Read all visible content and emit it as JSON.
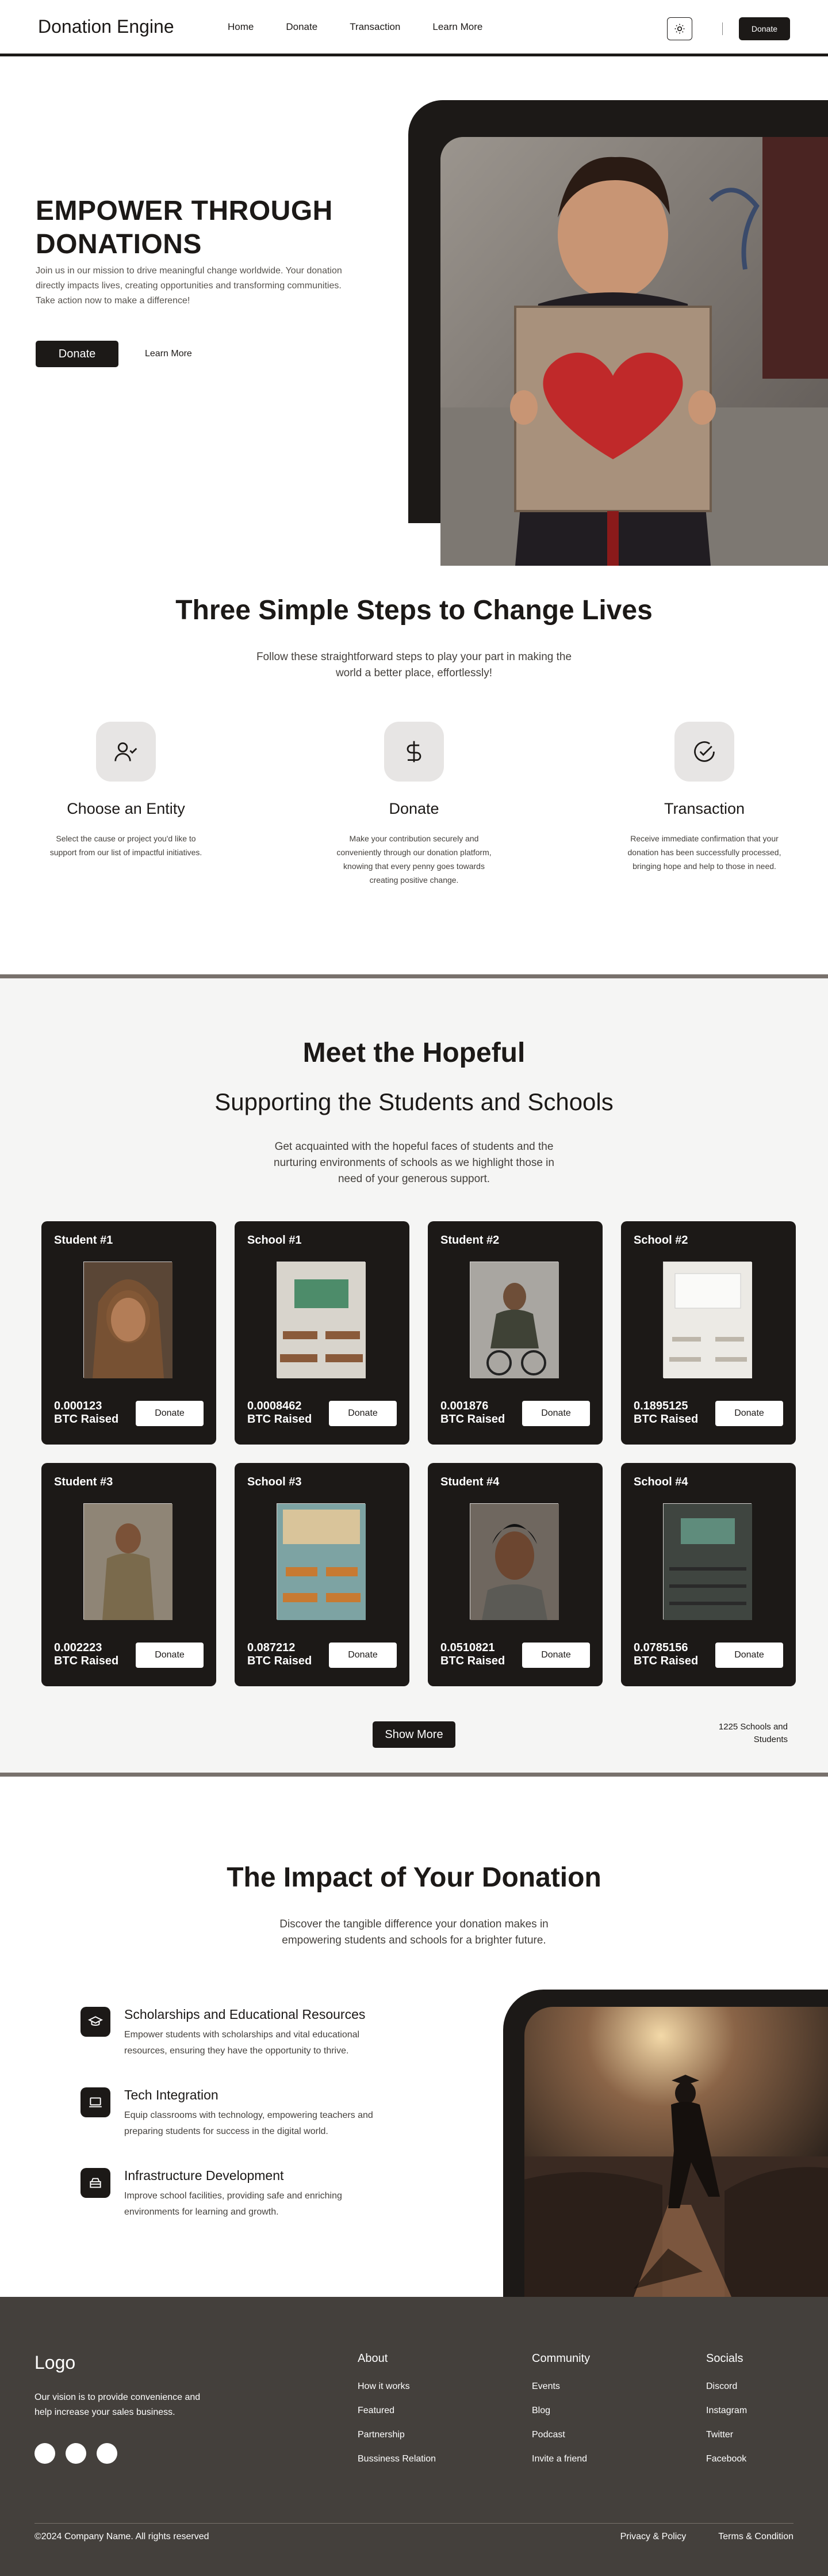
{
  "nav": {
    "brand": "Donation Engine",
    "links": [
      "Home",
      "Donate",
      "Transaction",
      "Learn More"
    ],
    "donate_label": "Donate",
    "theme_icon": "sun-icon"
  },
  "hero": {
    "title": "EMPOWER THROUGH DONATIONS",
    "subtitle": "Join us in our mission to drive meaningful change worldwide. Your donation directly impacts lives, creating opportunities and transforming communities. Take action now to make a difference!",
    "primary_label": "Donate",
    "secondary_label": "Learn More"
  },
  "steps": {
    "title": "Three Simple Steps to Change Lives",
    "lead": "Follow these straightforward steps to play your part in making the world a better place, effortlessly!",
    "items": [
      {
        "icon": "user-check-icon",
        "title": "Choose an Entity",
        "desc": "Select the cause or project you'd like to support from our list of impactful initiatives."
      },
      {
        "icon": "dollar-icon",
        "title": "Donate",
        "desc": "Make your contribution securely and conveniently through our donation platform, knowing that every penny goes towards creating positive change."
      },
      {
        "icon": "check-circle-icon",
        "title": "Transaction",
        "desc": "Receive immediate confirmation that your donation has been successfully processed, bringing hope and help to those in need."
      }
    ]
  },
  "meet": {
    "title": "Meet the Hopeful",
    "subtitle": "Supporting the Students and Schools",
    "lead": "Get acquainted with the hopeful faces of students and the nurturing environments of schools as we highlight those in need of your generous support.",
    "raised_label": "BTC Raised",
    "donate_label": "Donate",
    "cards": [
      {
        "title": "Student  #1",
        "amount": "0.000123",
        "kind": "student"
      },
      {
        "title": "School  #1",
        "amount": "0.0008462",
        "kind": "school"
      },
      {
        "title": "Student  #2",
        "amount": "0.001876",
        "kind": "student"
      },
      {
        "title": "School  #2",
        "amount": "0.1895125",
        "kind": "school"
      },
      {
        "title": "Student  #3",
        "amount": "0.002223",
        "kind": "student"
      },
      {
        "title": "School  #3",
        "amount": "0.087212",
        "kind": "school"
      },
      {
        "title": "Student  #4",
        "amount": "0.0510821",
        "kind": "student"
      },
      {
        "title": "School  #4",
        "amount": "0.0785156",
        "kind": "school"
      }
    ],
    "show_more_label": "Show More",
    "count_note": "1225 Schools and Students"
  },
  "impact": {
    "title": "The Impact of Your Donation",
    "lead": "Discover the tangible difference your donation makes in empowering students and schools for a brighter future.",
    "features": [
      {
        "icon": "graduation-cap-icon",
        "title": "Scholarships and Educational Resources",
        "desc": "Empower students with scholarships and vital educational resources, ensuring they have the opportunity to thrive."
      },
      {
        "icon": "laptop-icon",
        "title": "Tech Integration",
        "desc": "Equip classrooms with technology, empowering teachers and preparing students for success in the digital world."
      },
      {
        "icon": "building-icon",
        "title": "Infrastructure Development",
        "desc": "Improve school facilities, providing safe and enriching environments for learning and growth."
      }
    ]
  },
  "footer": {
    "logo": "Logo",
    "vision": "Our vision is to provide convenience and help increase your sales business.",
    "columns": [
      {
        "title": "About",
        "links": [
          "How it works",
          "Featured",
          "Partnership",
          "Bussiness Relation"
        ]
      },
      {
        "title": "Community",
        "links": [
          "Events",
          "Blog",
          "Podcast",
          "Invite a friend"
        ]
      },
      {
        "title": "Socials",
        "links": [
          "Discord",
          "Instagram",
          "Twitter",
          "Facebook"
        ]
      }
    ],
    "copyright": "©2024 Company Name. All rights reserved",
    "legal": [
      "Privacy & Policy",
      "Terms & Condition"
    ]
  }
}
